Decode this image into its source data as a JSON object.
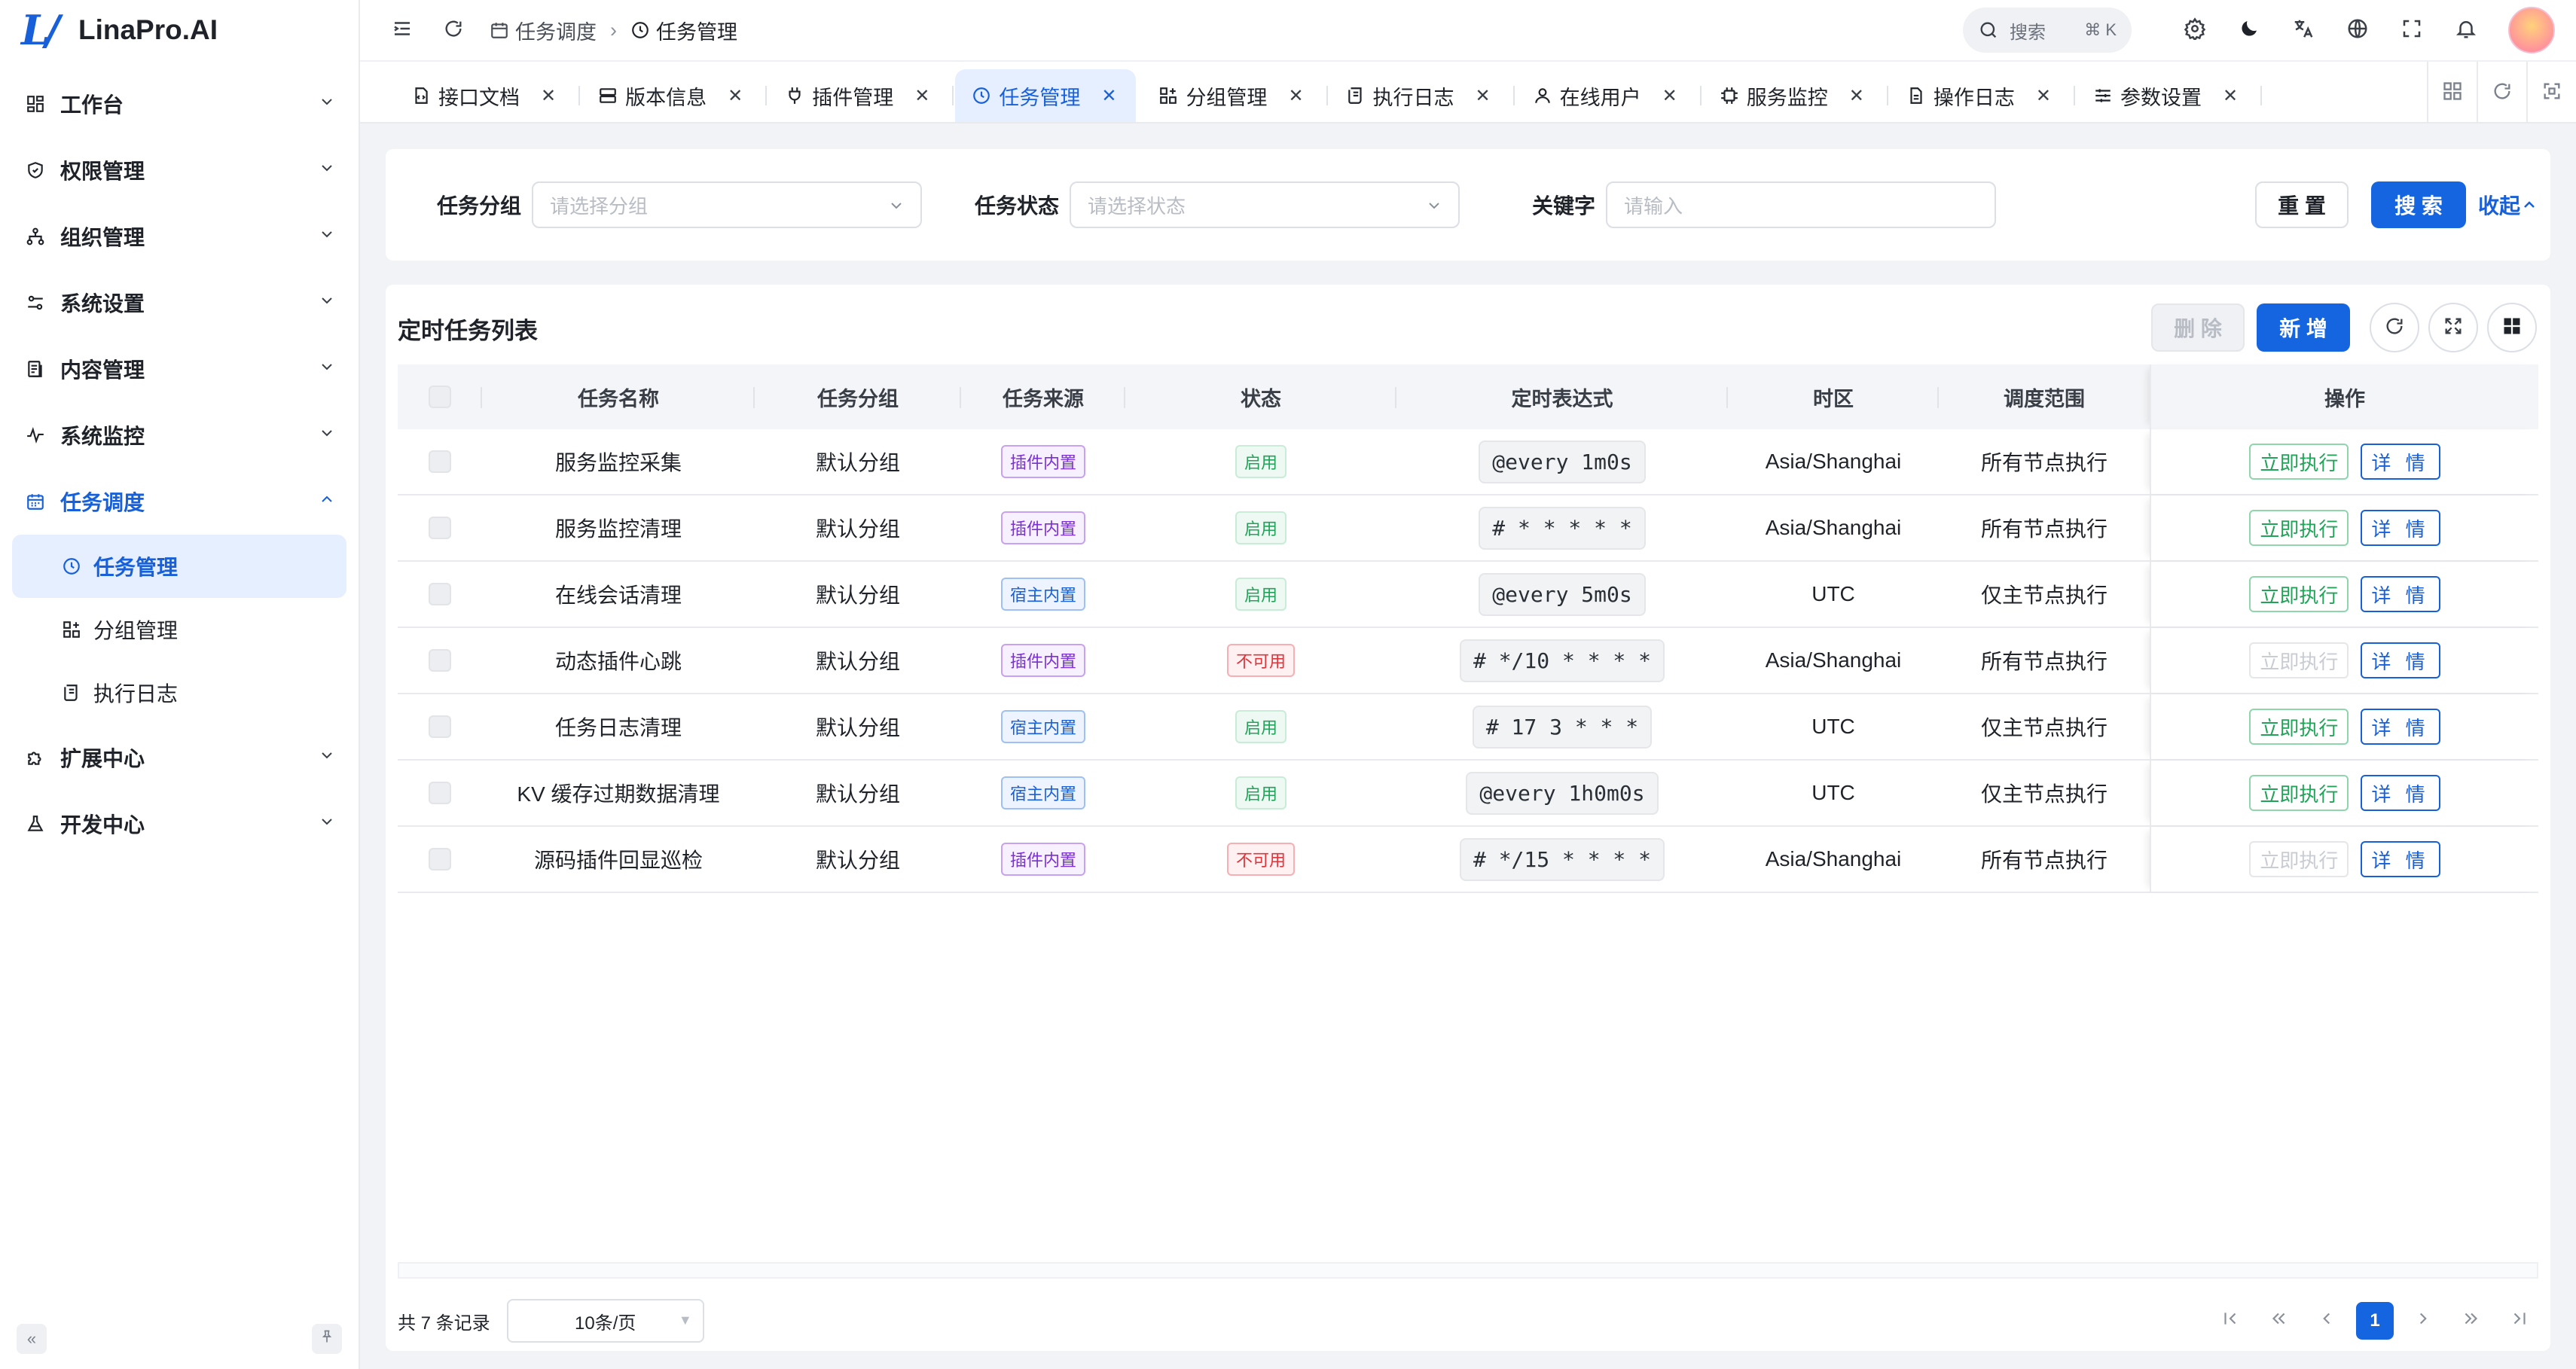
{
  "app": {
    "name": "LinaPro.AI"
  },
  "sidebar": {
    "items": [
      {
        "label": "工作台",
        "icon": "dashboard-icon"
      },
      {
        "label": "权限管理",
        "icon": "shield-icon"
      },
      {
        "label": "组织管理",
        "icon": "org-tree-icon"
      },
      {
        "label": "系统设置",
        "icon": "settings-sliders-icon"
      },
      {
        "label": "内容管理",
        "icon": "document-icon"
      },
      {
        "label": "系统监控",
        "icon": "pulse-icon"
      },
      {
        "label": "任务调度",
        "icon": "calendar-icon"
      },
      {
        "label": "扩展中心",
        "icon": "puzzle-icon"
      },
      {
        "label": "开发中心",
        "icon": "flask-icon"
      }
    ],
    "sub_items": [
      {
        "label": "任务管理",
        "icon": "clock-icon"
      },
      {
        "label": "分组管理",
        "icon": "grid-plus-icon"
      },
      {
        "label": "执行日志",
        "icon": "scroll-icon"
      }
    ]
  },
  "header": {
    "breadcrumb": [
      "任务调度",
      "任务管理"
    ],
    "search_label": "搜索",
    "search_shortcut": "⌘ K"
  },
  "tabs": [
    {
      "label": "接口文档",
      "icon": "doc-code-icon"
    },
    {
      "label": "版本信息",
      "icon": "server-icon"
    },
    {
      "label": "插件管理",
      "icon": "plug-icon"
    },
    {
      "label": "任务管理",
      "icon": "clock-icon"
    },
    {
      "label": "分组管理",
      "icon": "grid-plus-icon"
    },
    {
      "label": "执行日志",
      "icon": "scroll-icon"
    },
    {
      "label": "在线用户",
      "icon": "user-icon"
    },
    {
      "label": "服务监控",
      "icon": "chip-icon"
    },
    {
      "label": "操作日志",
      "icon": "file-icon"
    },
    {
      "label": "参数设置",
      "icon": "sliders-icon"
    }
  ],
  "filter": {
    "group_label": "任务分组",
    "group_placeholder": "请选择分组",
    "status_label": "任务状态",
    "status_placeholder": "请选择状态",
    "keyword_label": "关键字",
    "keyword_placeholder": "请输入",
    "reset": "重 置",
    "search": "搜 索",
    "collapse": "收起"
  },
  "table": {
    "title": "定时任务列表",
    "delete": "删 除",
    "add": "新 增",
    "columns": [
      "任务名称",
      "任务分组",
      "任务来源",
      "状态",
      "定时表达式",
      "时区",
      "调度范围",
      "操作"
    ],
    "rows": [
      {
        "name": "服务监控采集",
        "group": "默认分组",
        "source": "插件内置",
        "status": "启用",
        "cron": "@every 1m0s",
        "tz": "Asia/Shanghai",
        "scope": "所有节点执行",
        "run": "立即执行",
        "detail": "详 情"
      },
      {
        "name": "服务监控清理",
        "group": "默认分组",
        "source": "插件内置",
        "status": "启用",
        "cron": "# * * * * *",
        "tz": "Asia/Shanghai",
        "scope": "所有节点执行",
        "run": "立即执行",
        "detail": "详 情"
      },
      {
        "name": "在线会话清理",
        "group": "默认分组",
        "source": "宿主内置",
        "status": "启用",
        "cron": "@every 5m0s",
        "tz": "UTC",
        "scope": "仅主节点执行",
        "run": "立即执行",
        "detail": "详 情"
      },
      {
        "name": "动态插件心跳",
        "group": "默认分组",
        "source": "插件内置",
        "status": "不可用",
        "cron": "# */10 * * * *",
        "tz": "Asia/Shanghai",
        "scope": "所有节点执行",
        "run": "立即执行",
        "detail": "详 情"
      },
      {
        "name": "任务日志清理",
        "group": "默认分组",
        "source": "宿主内置",
        "status": "启用",
        "cron": "# 17 3 * * *",
        "tz": "UTC",
        "scope": "仅主节点执行",
        "run": "立即执行",
        "detail": "详 情"
      },
      {
        "name": "KV 缓存过期数据清理",
        "group": "默认分组",
        "source": "宿主内置",
        "status": "启用",
        "cron": "@every 1h0m0s",
        "tz": "UTC",
        "scope": "仅主节点执行",
        "run": "立即执行",
        "detail": "详 情"
      },
      {
        "name": "源码插件回显巡检",
        "group": "默认分组",
        "source": "插件内置",
        "status": "不可用",
        "cron": "# */15 * * * *",
        "tz": "Asia/Shanghai",
        "scope": "所有节点执行",
        "run": "立即执行",
        "detail": "详 情"
      }
    ]
  },
  "footer": {
    "total": "共 7 条记录",
    "page_size": "10条/页",
    "current_page": "1"
  },
  "colors": {
    "primary": "#1565e0",
    "active_bg": "#e6efff",
    "enabled": "#23a35a",
    "disabled": "#e0343b",
    "plugin": "#7b2fd6"
  }
}
